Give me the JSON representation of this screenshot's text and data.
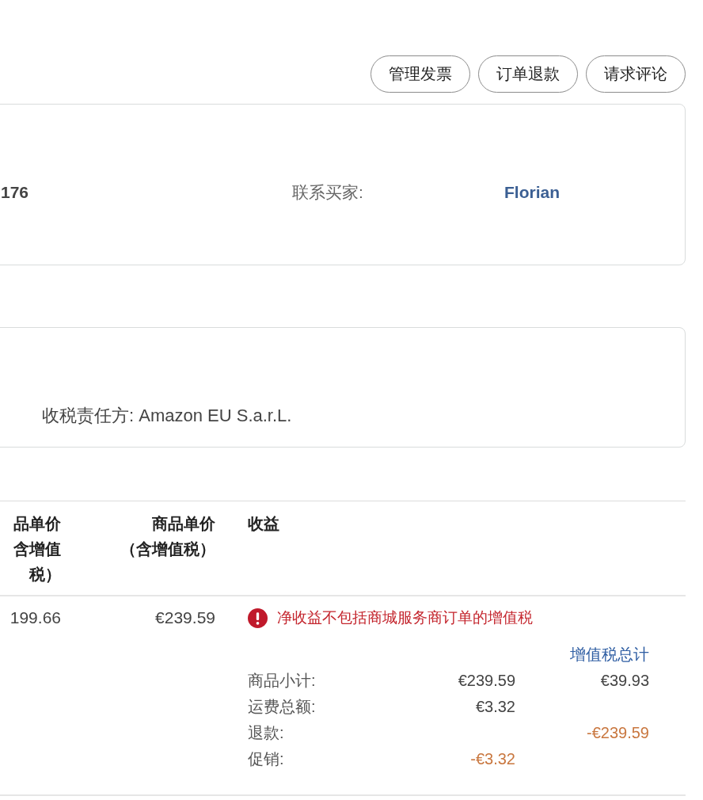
{
  "actions": [
    {
      "label": "管理发票"
    },
    {
      "label": "订单退款"
    },
    {
      "label": "请求评论"
    }
  ],
  "order_card": {
    "value_1": "176",
    "contact_label": "联系买家:",
    "buyer_name": "Florian"
  },
  "tax_card": {
    "text": "收税责任方: Amazon EU S.a.r.L."
  },
  "table": {
    "columns": [
      {
        "lines": [
          "品单价",
          "含增值",
          "税）"
        ]
      },
      {
        "lines": [
          "商品单价",
          "（含增值税）"
        ]
      },
      {
        "lines": [
          "收益"
        ]
      }
    ],
    "rows": [
      {
        "cells": [
          "199.66",
          "€239.59"
        ],
        "revenue": {
          "warning": "净收益不包括商城服务商订单的增值税",
          "vat_heading": "增值税总计",
          "lines": [
            {
              "label": "商品小计:",
              "amount": {
                "text": "€239.59",
                "negative": false
              },
              "vat": {
                "text": "€39.93",
                "negative": false
              }
            },
            {
              "label": "运费总额:",
              "amount": {
                "text": "€3.32",
                "negative": false
              }
            },
            {
              "label": "退款:",
              "vat": {
                "text": "-€239.59",
                "negative": true
              }
            },
            {
              "label": "促销:",
              "amount": {
                "text": "-€3.32",
                "negative": true
              }
            }
          ]
        }
      }
    ]
  }
}
